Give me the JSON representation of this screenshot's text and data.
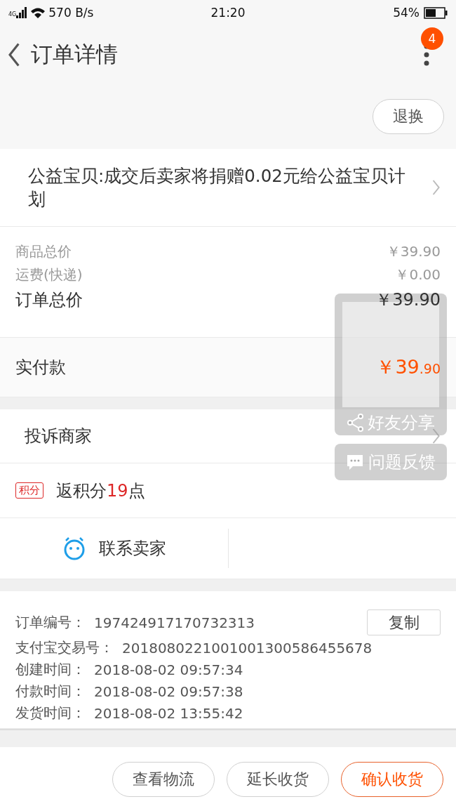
{
  "status_bar": {
    "network": "4G",
    "speed": "570 B/s",
    "time": "21:20",
    "battery": "54%"
  },
  "header": {
    "title": "订单详情",
    "badge": "4"
  },
  "return_button": "退换",
  "charity_notice": "公益宝贝:成交后卖家将捐赠0.02元给公益宝贝计划",
  "prices": [
    {
      "label": "商品总价",
      "value": "￥39.90",
      "kind": "minor"
    },
    {
      "label": "运费(快递)",
      "value": "￥0.00",
      "kind": "minor"
    },
    {
      "label": "订单总价",
      "value": "￥39.90",
      "kind": "total"
    }
  ],
  "paid": {
    "label": "实付款",
    "value": "￥39.90"
  },
  "complaint": "投诉商家",
  "points": {
    "tag": "积分",
    "prefix": "返积分",
    "number": "19",
    "suffix": "点"
  },
  "contact": "联系卖家",
  "order_info": [
    {
      "label": "订单编号：",
      "value": "197424917170732313"
    },
    {
      "label": "支付宝交易号：",
      "value": "2018080221001001300586455678"
    },
    {
      "label": "创建时间：",
      "value": "2018-08-02 09:57:34"
    },
    {
      "label": "付款时间：",
      "value": "2018-08-02 09:57:38"
    },
    {
      "label": "发货时间：",
      "value": "2018-08-02 13:55:42"
    }
  ],
  "copy_button": "复制",
  "actions": [
    {
      "label": "查看物流",
      "primary": false
    },
    {
      "label": "延长收货",
      "primary": false
    },
    {
      "label": "确认收货",
      "primary": true
    }
  ],
  "overlay": {
    "share": "好友分享",
    "feedback": "问题反馈"
  }
}
